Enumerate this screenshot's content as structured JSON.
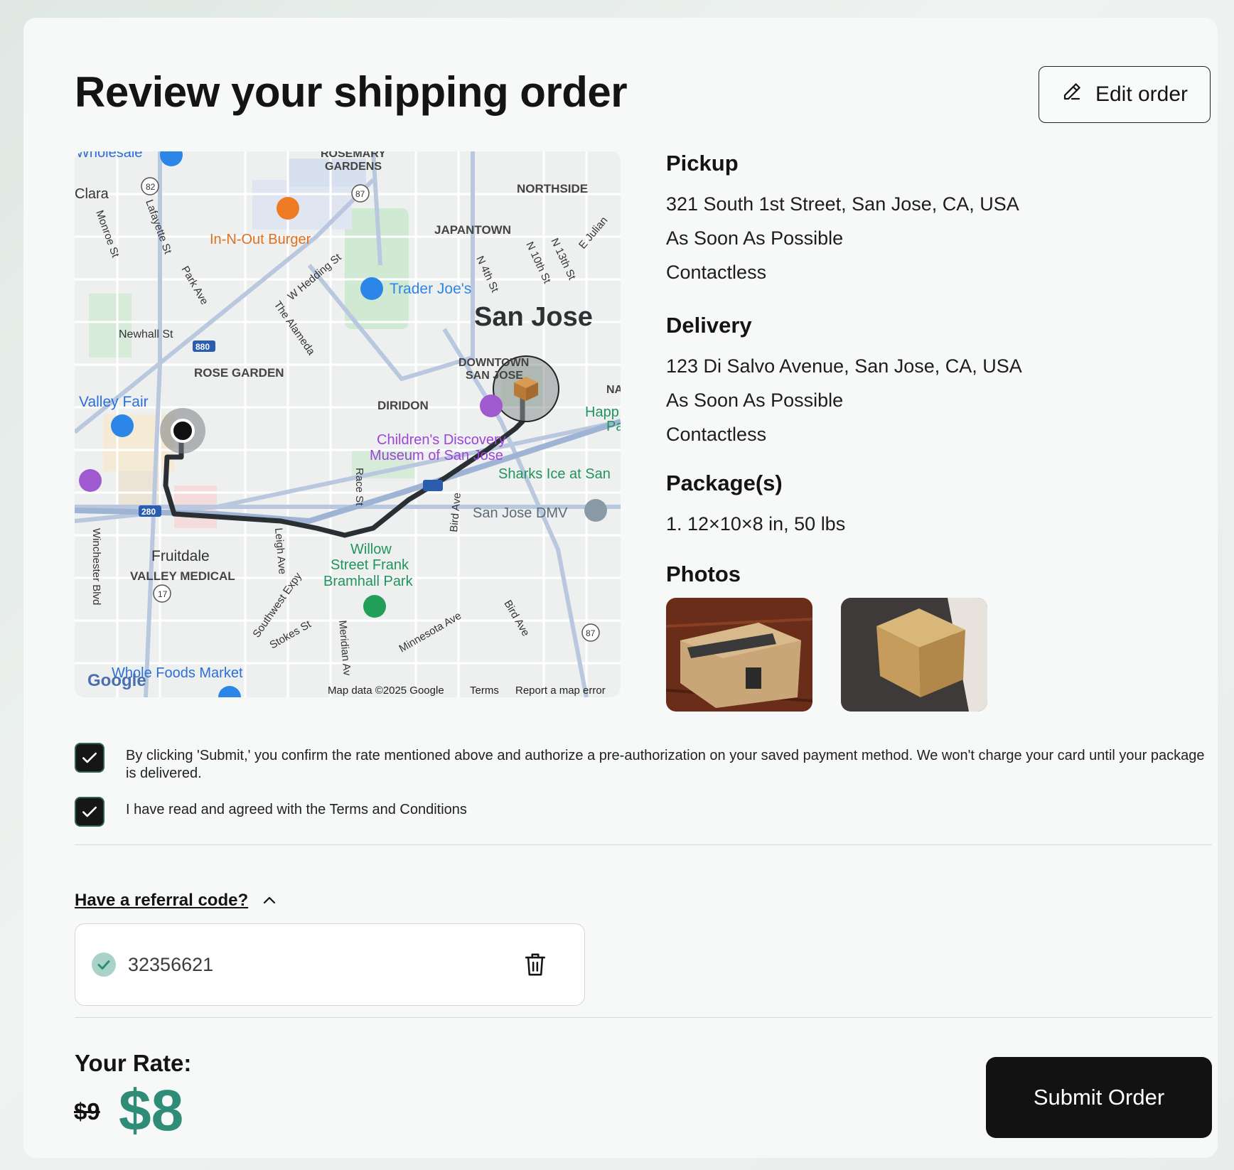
{
  "header": {
    "title": "Review your shipping order",
    "edit_label": "Edit order"
  },
  "map": {
    "labels": {
      "wholesale": "Wholesale",
      "rosemary_gardens_1": "ROSEMARY",
      "rosemary_gardens_2": "GARDENS",
      "northside": "NORTHSIDE",
      "clara": "Clara",
      "japantown": "JAPANTOWN",
      "in_n_out": "In-N-Out Burger",
      "trader_joes": "Trader Joe's",
      "san_jose": "San Jose",
      "newhall": "Newhall St",
      "rose_garden": "ROSE GARDEN",
      "downtown_1": "DOWNTOWN",
      "downtown_2": "SAN JOSE",
      "valley_fair": "Valley Fair",
      "diridon": "DIRIDON",
      "happ_1": "Happ",
      "happ_2": "Pa",
      "childrens_1": "Children's Discovery",
      "childrens_2": "Museum of San Jose",
      "sharks": "Sharks Ice at San",
      "dmv": "San Jose DMV",
      "fruitdale": "Fruitdale",
      "valley_medical": "VALLEY MEDICAL",
      "willow_1": "Willow",
      "willow_2": "Street Frank",
      "willow_3": "Bramhall Park",
      "whole_foods": "Whole Foods Market",
      "lafayette": "Lafayette St",
      "monroe": "Monroe St",
      "park_ave": "Park Ave",
      "w_hedding": "W Hedding St",
      "the_alameda": "The Alameda",
      "n4th": "N 4th St",
      "n10th": "N 10th St",
      "n13th": "N 13th St",
      "e_julian": "E Julian",
      "race_st": "Race St",
      "bird_ave": "Bird Ave",
      "leigh_ave": "Leigh Ave",
      "southwest_expy": "Southwest Expy",
      "stokes": "Stokes St",
      "meridian": "Meridian Av",
      "minnesota": "Minnesota Ave",
      "bird_ave_2": "Bird Ave",
      "winchester": "Winchester Blvd",
      "na": "NA",
      "s82": "82",
      "s87": "87",
      "s880": "880",
      "s280": "280",
      "s17": "17",
      "s87b": "87",
      "google": "Google",
      "map_data": "Map data ©2025 Google",
      "terms": "Terms",
      "report": "Report a map error"
    }
  },
  "pickup": {
    "heading": "Pickup",
    "address": "321 South 1st Street, San Jose, CA, USA",
    "timing": "As Soon As Possible",
    "method": "Contactless"
  },
  "delivery": {
    "heading": "Delivery",
    "address": "123 Di Salvo Avenue, San Jose, CA, USA",
    "timing": "As Soon As Possible",
    "method": "Contactless"
  },
  "packages": {
    "heading": "Package(s)",
    "items": [
      "1. 12×10×8 in, 50 lbs"
    ]
  },
  "photos": {
    "heading": "Photos"
  },
  "agreements": [
    {
      "checked": true,
      "text": "By clicking 'Submit,' you confirm the rate mentioned above and authorize a pre-authorization on your saved payment method. We won't charge your card until your package is delivered."
    },
    {
      "checked": true,
      "text": "I have read and agreed with the Terms and Conditions"
    }
  ],
  "referral": {
    "toggle_label": "Have a referral code?",
    "code": "32356621"
  },
  "rate": {
    "label": "Your Rate:",
    "old_price": "$9",
    "new_price": "$8"
  },
  "submit_label": "Submit Order",
  "colors": {
    "accent": "#2f8c77",
    "primary_button": "#121212"
  }
}
